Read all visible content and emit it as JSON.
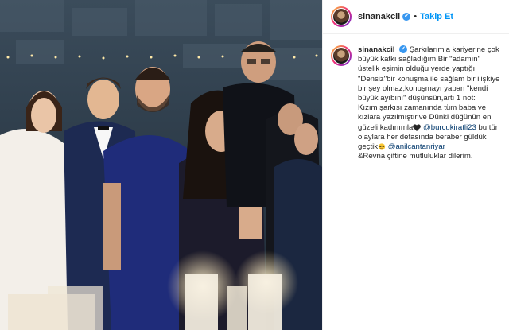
{
  "post": {
    "username": "sinanakcil",
    "follow_label": "Takip Et",
    "separator": "•",
    "verified_glyph": "✔"
  },
  "caption": {
    "username": "sinanakcil",
    "part1": "Şarkılarımla kariyerine çok büyük katkı sağladığım Bir \"adamın\" üstelik eşimin olduğu yerde yaptığı \"Densiz\"bir konuşma ile sağlam bir ilişkiye bir şey olmaz,konuşmayı yapan \"kendi büyük ayıbını\" düşünsün,artı 1 not:",
    "part2": "Kızım şarkısı zamanında tüm baba ve kızlara yazılmıştır.ve Dünki düğünün en güzeli kadınımla",
    "mention1": "@burcukiratli23",
    "part3": " bu tür olaylara her defasında beraber güldük geçtik",
    "mention2": "@anilcantanriyar",
    "part4": "&Revna çiftine mutluluklar dilerim.",
    "emojis": [
      "heart-emoji",
      "sunglasses-emoji"
    ]
  },
  "colors": {
    "link_blue": "#0095f6",
    "mention_blue": "#00376b",
    "verified_blue": "#3897f0",
    "text": "#262626"
  }
}
